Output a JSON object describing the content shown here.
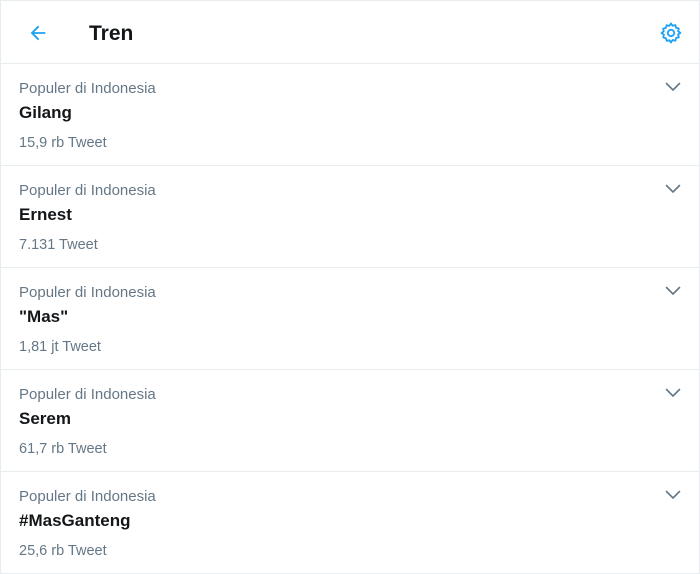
{
  "header": {
    "title": "Tren",
    "back_icon": "arrow-left-icon",
    "settings_icon": "gear-icon"
  },
  "colors": {
    "accent": "#1da1f2",
    "primary_text": "#14171a",
    "secondary_text": "#657786",
    "divider": "#e6ecf0"
  },
  "trends": [
    {
      "context": "Populer di Indonesia",
      "name": "Gilang",
      "count": "15,9 rb Tweet"
    },
    {
      "context": "Populer di Indonesia",
      "name": "Ernest",
      "count": "7.131 Tweet"
    },
    {
      "context": "Populer di Indonesia",
      "name": "\"Mas\"",
      "count": "1,81 jt Tweet"
    },
    {
      "context": "Populer di Indonesia",
      "name": "Serem",
      "count": "61,7 rb Tweet"
    },
    {
      "context": "Populer di Indonesia",
      "name": "#MasGanteng",
      "count": "25,6 rb Tweet"
    }
  ]
}
